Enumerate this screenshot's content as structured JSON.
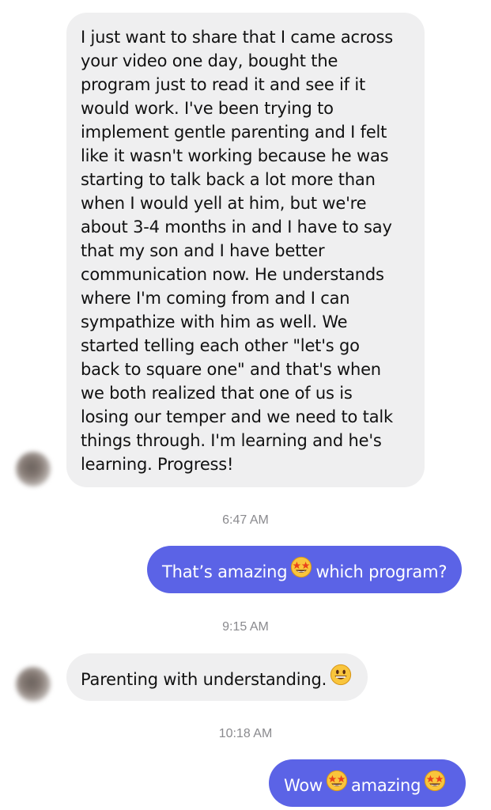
{
  "conversation": {
    "messages": [
      {
        "direction": "incoming",
        "text": "I just want to share that I came across\nyour video one day, bought the\nprogram just to read it and see if it\nwould work. I've been trying to\nimplement gentle parenting and I felt\nlike it wasn't working because he was\nstarting to talk back a lot more than\nwhen I would yell at him, but we're\nabout 3-4 months in and I have to say\nthat my son and I have better\ncommunication now. He understands\nwhere I'm coming from and I can\nsympathize with him as well. We\nstarted telling each other \"let's go\nback to square one\" and that's when\nwe both realized that one of us is\nlosing our temper and we need to talk\nthings through. I'm learning and he's\nlearning. Progress!"
      },
      {
        "direction": "outgoing",
        "timestamp": "6:47 AM",
        "text_before": "That’s amazing",
        "emoji": "star-struck",
        "text_after": "which program?"
      },
      {
        "direction": "incoming",
        "timestamp": "9:15 AM",
        "text_before": "Parenting with understanding.",
        "emoji": "grinning-face"
      },
      {
        "direction": "outgoing",
        "timestamp": "10:18 AM",
        "text_before": "Wow",
        "emoji": "star-struck",
        "text_after": "amazing",
        "emoji_after": "star-struck"
      }
    ]
  },
  "colors": {
    "incoming_bubble": "#efeff0",
    "outgoing_bubble": "#5b63e6",
    "timestamp_text": "#8a8a8e"
  }
}
